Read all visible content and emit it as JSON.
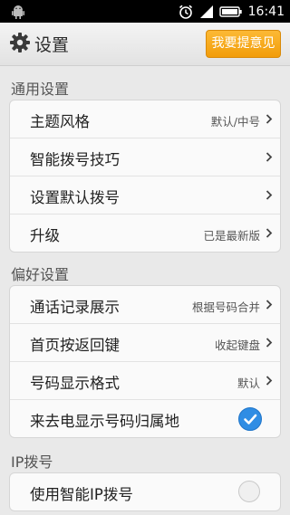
{
  "status_bar": {
    "time": "16:41"
  },
  "header": {
    "title": "设置",
    "feedback_button": "我要提意见"
  },
  "sections": [
    {
      "title": "通用设置",
      "items": [
        {
          "label": "主题风格",
          "value": "默认/中号"
        },
        {
          "label": "智能拨号技巧",
          "value": ""
        },
        {
          "label": "设置默认拨号",
          "value": ""
        },
        {
          "label": "升级",
          "value": "已是最新版"
        }
      ]
    },
    {
      "title": "偏好设置",
      "items": [
        {
          "label": "通话记录展示",
          "value": "根据号码合并"
        },
        {
          "label": "首页按返回键",
          "value": "收起键盘"
        },
        {
          "label": "号码显示格式",
          "value": "默认"
        },
        {
          "label": "来去电显示号码归属地",
          "checked": true
        }
      ]
    },
    {
      "title": "IP拨号",
      "items": [
        {
          "label": "使用智能IP拨号",
          "checked": false
        }
      ]
    }
  ],
  "colors": {
    "accent": "#f29d0a",
    "check_on": "#2f8de4"
  }
}
